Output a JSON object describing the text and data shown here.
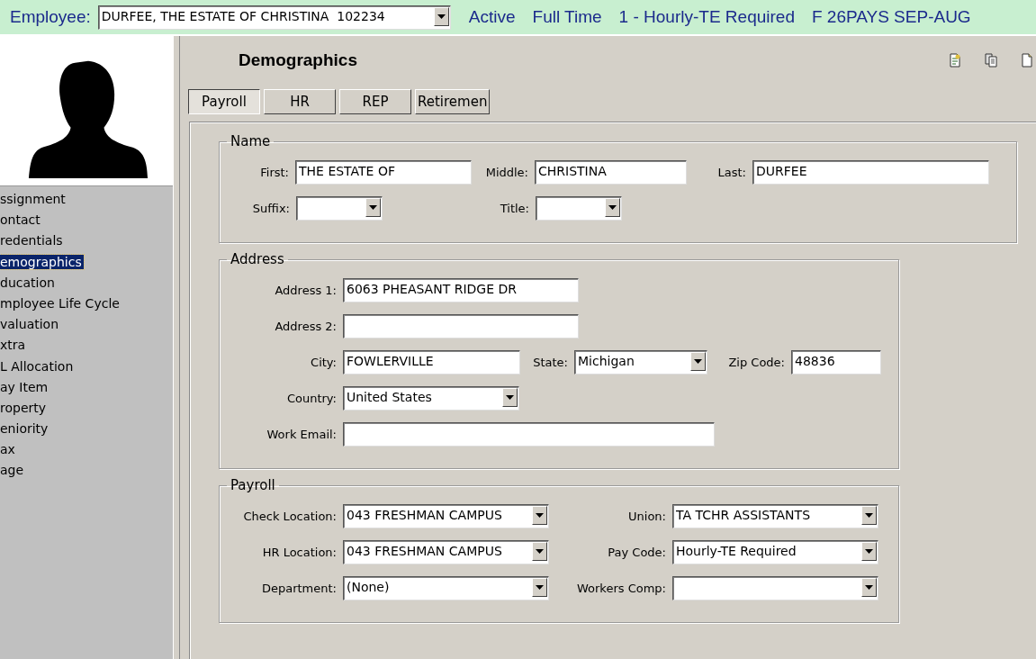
{
  "header": {
    "label": "Employee:",
    "employee": "DURFEE, THE ESTATE OF CHRISTINA  102234",
    "status": [
      "Active",
      "Full Time",
      "1 - Hourly-TE Required",
      "F 26PAYS SEP-AUG"
    ]
  },
  "sidebar": {
    "items": [
      {
        "label": "ssignment",
        "selected": false
      },
      {
        "label": "ontact",
        "selected": false
      },
      {
        "label": "redentials",
        "selected": false
      },
      {
        "label": "emographics",
        "selected": true
      },
      {
        "label": "ducation",
        "selected": false
      },
      {
        "label": "mployee Life Cycle",
        "selected": false
      },
      {
        "label": "valuation",
        "selected": false
      },
      {
        "label": "xtra",
        "selected": false
      },
      {
        "label": "L Allocation",
        "selected": false
      },
      {
        "label": "ay Item",
        "selected": false
      },
      {
        "label": "roperty",
        "selected": false
      },
      {
        "label": "eniority",
        "selected": false
      },
      {
        "label": "ax",
        "selected": false
      },
      {
        "label": "age",
        "selected": false
      }
    ]
  },
  "panel": {
    "title": "Demographics",
    "tabs": [
      {
        "label": "Payroll",
        "selected": true
      },
      {
        "label": "HR",
        "selected": false
      },
      {
        "label": "REP",
        "selected": false
      },
      {
        "label": "Retiremen",
        "selected": false
      }
    ],
    "groups": [
      {
        "title": "Name",
        "rows": [
          [
            {
              "label": "First:",
              "kind": "text",
              "value": "THE ESTATE OF"
            },
            {
              "label": "Middle:",
              "kind": "text",
              "value": "CHRISTINA"
            },
            {
              "label": "Last:",
              "kind": "text",
              "value": "DURFEE"
            }
          ],
          [
            {
              "label": "Suffix:",
              "kind": "combo"
            },
            {
              "label": "Title:",
              "kind": "combo"
            }
          ]
        ]
      },
      {
        "title": "Address",
        "rows": [
          [
            {
              "label": "Address 1:",
              "kind": "text",
              "value": "6063 PHEASANT RIDGE DR"
            }
          ],
          [
            {
              "label": "Address 2:",
              "kind": "text"
            }
          ],
          [
            {
              "label": "City:",
              "kind": "text",
              "value": "FOWLERVILLE"
            },
            {
              "label": "State:",
              "kind": "combo",
              "value": "Michigan"
            },
            {
              "label": "Zip Code:",
              "kind": "text",
              "value": "48836"
            }
          ],
          [
            {
              "label": "Country:",
              "kind": "combo",
              "value": "United States"
            }
          ],
          [
            {
              "label": "Work Email:",
              "kind": "text"
            }
          ]
        ]
      },
      {
        "title": "Payroll",
        "rows": [
          [
            {
              "label": "Check Location:",
              "kind": "combo",
              "value": "043 FRESHMAN CAMPUS"
            },
            {
              "label": "Union:",
              "kind": "combo",
              "value": "TA TCHR ASSISTANTS"
            }
          ],
          [
            {
              "label": "HR Location:",
              "kind": "combo",
              "value": "043 FRESHMAN CAMPUS"
            },
            {
              "label": "Pay Code:",
              "kind": "combo",
              "value": "Hourly-TE Required"
            }
          ],
          [
            {
              "label": "Department:",
              "kind": "combo",
              "value": "(None)"
            },
            {
              "label": "Workers Comp:",
              "kind": "combo"
            }
          ]
        ]
      }
    ]
  }
}
